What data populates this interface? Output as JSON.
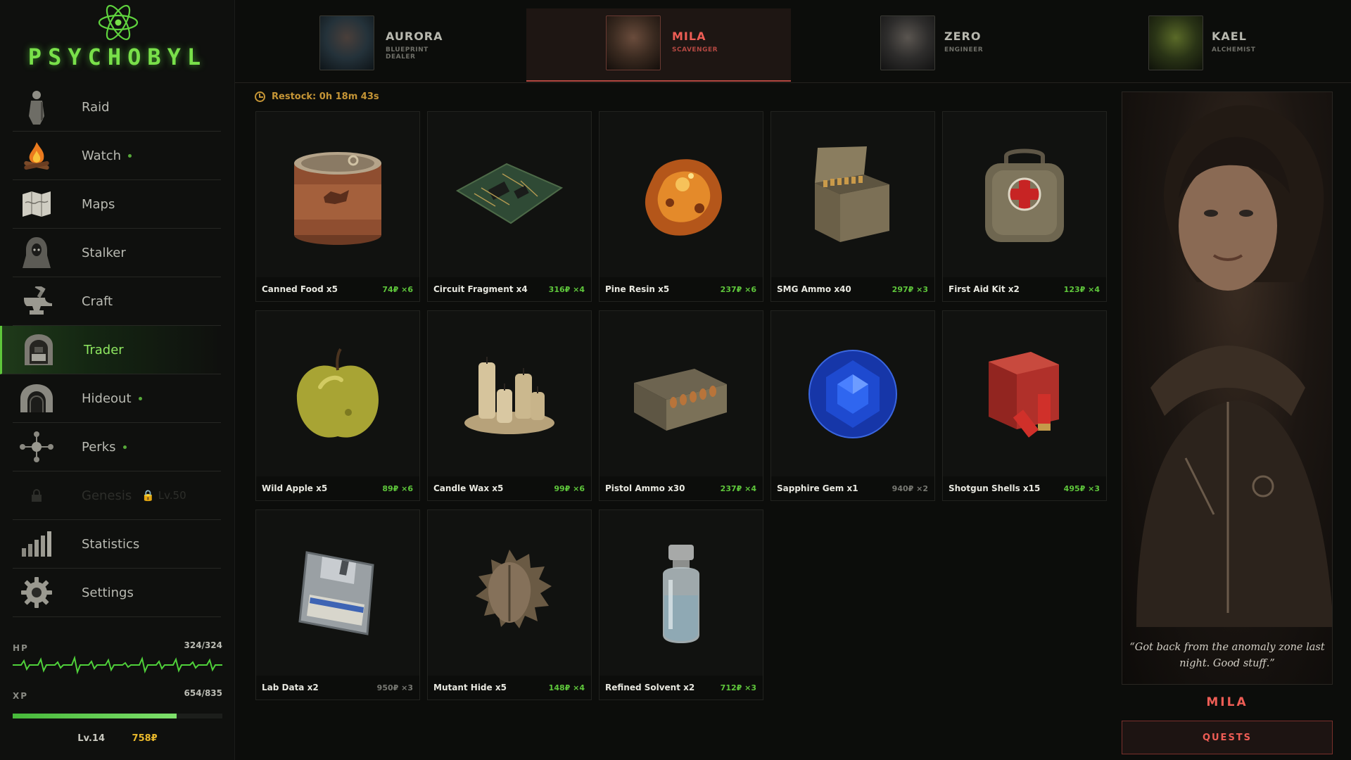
{
  "app": {
    "title": "PSYCHOBYL"
  },
  "sidebar": {
    "items": [
      {
        "label": "Raid",
        "icon": "stalker-figure-icon",
        "dot": false
      },
      {
        "label": "Watch",
        "icon": "campfire-icon",
        "dot": true
      },
      {
        "label": "Maps",
        "icon": "map-icon",
        "dot": false
      },
      {
        "label": "Stalker",
        "icon": "hooded-stalker-icon",
        "dot": false
      },
      {
        "label": "Craft",
        "icon": "anvil-icon",
        "dot": false
      },
      {
        "label": "Trader",
        "icon": "trader-stall-icon",
        "dot": false,
        "active": true
      },
      {
        "label": "Hideout",
        "icon": "bunker-icon",
        "dot": true
      },
      {
        "label": "Perks",
        "icon": "perk-tree-icon",
        "dot": true
      },
      {
        "label": "Genesis",
        "icon": "lock-icon",
        "locked": true,
        "level": "Lv.50"
      },
      {
        "label": "Statistics",
        "icon": "bar-chart-icon",
        "dot": false
      },
      {
        "label": "Settings",
        "icon": "gear-icon",
        "dot": false
      }
    ],
    "hp": {
      "label": "HP",
      "value": "324/324"
    },
    "xp": {
      "label": "XP",
      "value": "654/835",
      "fill": 0.783
    },
    "level": "Lv.14",
    "money": "758₽"
  },
  "tabs": [
    {
      "name": "AURORA",
      "role": "BLUEPRINT DEALER",
      "active": false
    },
    {
      "name": "MILA",
      "role": "SCAVENGER",
      "active": true
    },
    {
      "name": "ZERO",
      "role": "ENGINEER",
      "active": false
    },
    {
      "name": "KAEL",
      "role": "ALCHEMIST",
      "active": false
    }
  ],
  "restock": {
    "label": "Restock: 0h 18m 43s"
  },
  "items": [
    {
      "name": "Canned Food x5",
      "price": "74₽ ×6",
      "icon": "canned-food-icon"
    },
    {
      "name": "Circuit Fragment x4",
      "price": "316₽ ×4",
      "icon": "circuit-board-icon"
    },
    {
      "name": "Pine Resin x5",
      "price": "237₽ ×6",
      "icon": "pine-resin-icon"
    },
    {
      "name": "SMG Ammo x40",
      "price": "297₽ ×3",
      "icon": "ammo-box-icon"
    },
    {
      "name": "First Aid Kit x2",
      "price": "123₽ ×4",
      "icon": "first-aid-kit-icon"
    },
    {
      "name": "Wild Apple x5",
      "price": "89₽ ×6",
      "icon": "apple-icon"
    },
    {
      "name": "Candle Wax x5",
      "price": "99₽ ×6",
      "icon": "candles-icon"
    },
    {
      "name": "Pistol Ammo x30",
      "price": "237₽ ×4",
      "icon": "pistol-ammo-icon"
    },
    {
      "name": "Sapphire Gem x1",
      "price": "940₽ ×2",
      "icon": "sapphire-icon",
      "dim": true
    },
    {
      "name": "Shotgun Shells x15",
      "price": "495₽ ×3",
      "icon": "shotgun-shells-icon"
    },
    {
      "name": "Lab Data x2",
      "price": "950₽ ×3",
      "icon": "floppy-disk-icon",
      "dim": true
    },
    {
      "name": "Mutant Hide x5",
      "price": "148₽ ×4",
      "icon": "mutant-hide-icon"
    },
    {
      "name": "Refined Solvent x2",
      "price": "712₽ ×3",
      "icon": "solvent-vial-icon"
    }
  ],
  "trader": {
    "quote": "“Got back from the anomaly zone last night. Good stuff.”",
    "name": "MILA",
    "quests_label": "QUESTS"
  }
}
